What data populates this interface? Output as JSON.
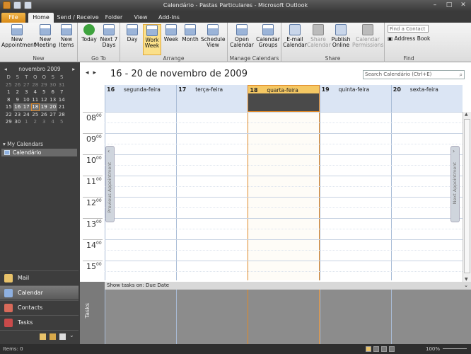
{
  "window": {
    "title": "Calendário - Pastas Particulares - Microsoft Outlook"
  },
  "tabs": [
    {
      "label": "File"
    },
    {
      "label": "Home"
    },
    {
      "label": "Send / Receive"
    },
    {
      "label": "Folder"
    },
    {
      "label": "View"
    },
    {
      "label": "Add-Ins"
    }
  ],
  "ribbon": {
    "new": {
      "label": "New",
      "new_appointment": "New Appointment",
      "new_meeting": "New Meeting",
      "new_items": "New Items"
    },
    "goto": {
      "label": "Go To",
      "today": "Today",
      "next7": "Next 7 Days"
    },
    "arrange": {
      "label": "Arrange",
      "day": "Day",
      "work_week": "Work Week",
      "week": "Week",
      "month": "Month",
      "schedule": "Schedule View"
    },
    "manage": {
      "label": "Manage Calendars",
      "open": "Open Calendar",
      "groups": "Calendar Groups"
    },
    "share": {
      "label": "Share",
      "email": "E-mail Calendar",
      "share": "Share Calendar",
      "publish": "Publish Online",
      "permissions": "Calendar Permissions"
    },
    "find": {
      "label": "Find",
      "contact_placeholder": "Find a Contact",
      "address_book": "Address Book"
    }
  },
  "minical": {
    "month": "novembro 2009",
    "dow": [
      "D",
      "S",
      "T",
      "Q",
      "Q",
      "S",
      "S"
    ],
    "weeks": [
      [
        "25",
        "26",
        "27",
        "28",
        "29",
        "30",
        "31"
      ],
      [
        "1",
        "2",
        "3",
        "4",
        "5",
        "6",
        "7"
      ],
      [
        "8",
        "9",
        "10",
        "11",
        "12",
        "13",
        "14"
      ],
      [
        "15",
        "16",
        "17",
        "18",
        "19",
        "20",
        "21"
      ],
      [
        "22",
        "23",
        "24",
        "25",
        "26",
        "27",
        "28"
      ],
      [
        "29",
        "30",
        "1",
        "2",
        "3",
        "4",
        "5"
      ]
    ]
  },
  "my_calendars": {
    "header": "My Calendars",
    "item": "Calendário"
  },
  "nav": {
    "mail": "Mail",
    "calendar": "Calendar",
    "contacts": "Contacts",
    "tasks": "Tasks"
  },
  "calendar": {
    "date_range": "16 - 20 de novembro de 2009",
    "search_placeholder": "Search Calendário (Ctrl+E)",
    "days": [
      {
        "num": "16",
        "name": "segunda-feira"
      },
      {
        "num": "17",
        "name": "terça-feira"
      },
      {
        "num": "18",
        "name": "quarta-feira"
      },
      {
        "num": "19",
        "name": "quinta-feira"
      },
      {
        "num": "20",
        "name": "sexta-feira"
      }
    ],
    "hours": [
      "08",
      "09",
      "10",
      "11",
      "12",
      "13",
      "14",
      "15"
    ],
    "minutes": "00",
    "prev_appointment": "Previous Appointment",
    "next_appointment": "Next Appointment"
  },
  "tasks": {
    "label": "Tasks",
    "show_on": "Show tasks on: Due Date"
  },
  "status": {
    "items": "Items: 0",
    "zoom": "100%"
  }
}
